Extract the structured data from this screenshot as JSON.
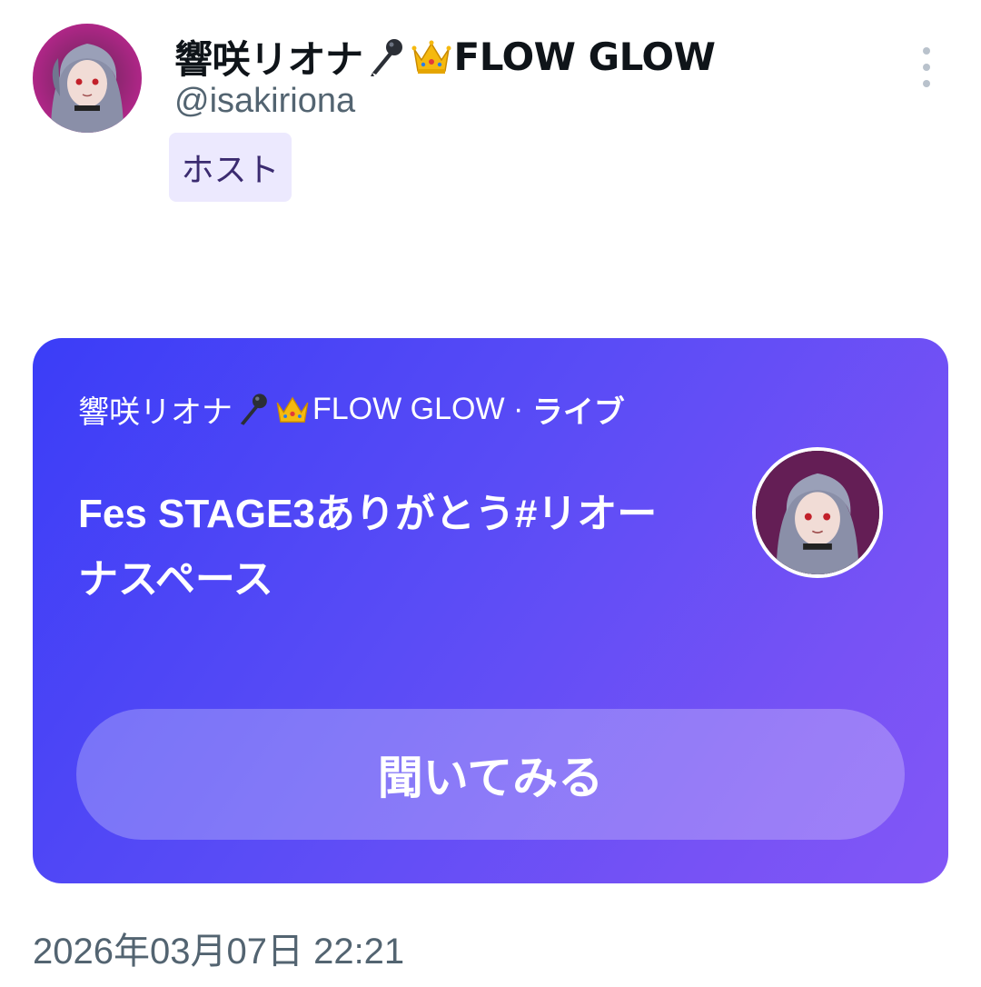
{
  "header": {
    "display_name": "響咲リオナ",
    "display_name_suffix": "FLOW GLOW",
    "handle": "@isakiriona",
    "role_badge": "ホスト"
  },
  "icons": {
    "emoji_1": "microphone-icon",
    "emoji_2": "crown-icon",
    "more": "more-vertical-icon"
  },
  "space_card": {
    "host_name": "響咲リオナ",
    "host_suffix": "FLOW GLOW",
    "separator": " · ",
    "status": "ライブ",
    "title": "Fes STAGE3ありがとう#リオーナスペース",
    "listen_label": "聞いてみる",
    "colors": {
      "gradient_start": "#3b3df7",
      "gradient_end": "#8257f6"
    }
  },
  "timestamp": "2026年03月07日 22:21"
}
